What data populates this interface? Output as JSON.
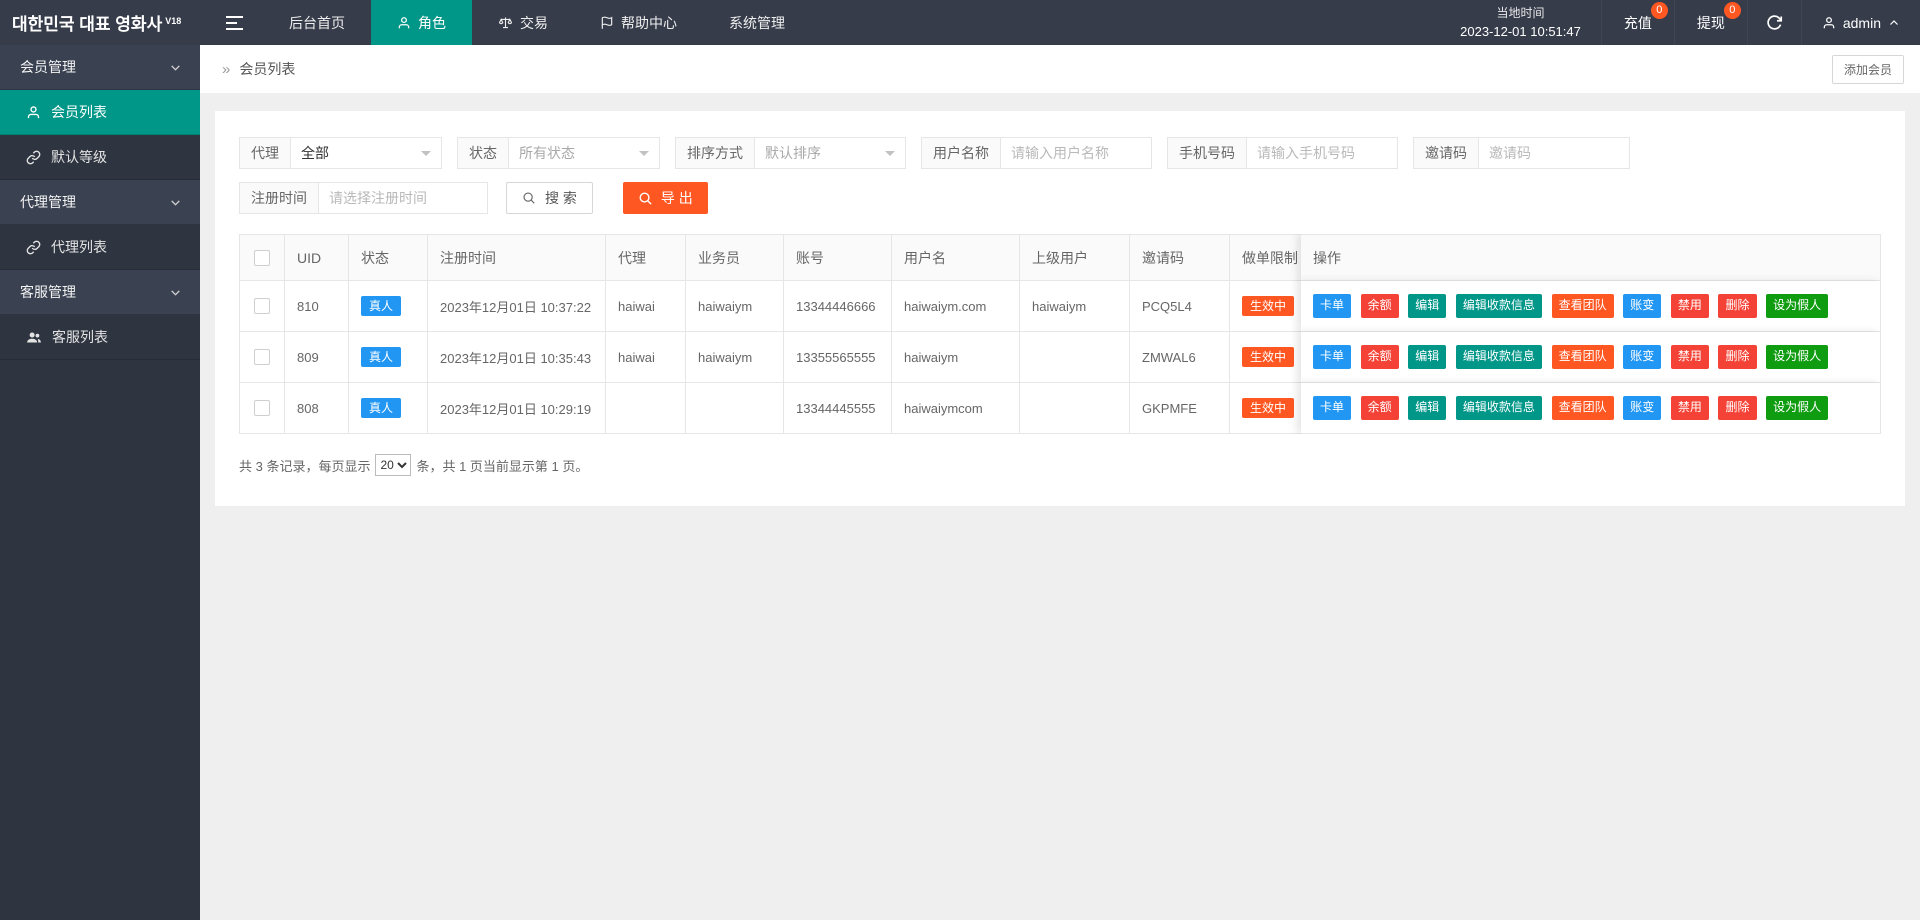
{
  "brand": {
    "title": "대한민국 대표 영화사",
    "version": "V18"
  },
  "topbar": {
    "nav": [
      {
        "label": "后台首页"
      },
      {
        "label": "角色"
      },
      {
        "label": "交易"
      },
      {
        "label": "帮助中心"
      },
      {
        "label": "系统管理"
      }
    ],
    "local_time_label": "当地时间",
    "local_time": "2023-12-01 10:51:47",
    "recharge_label": "充值",
    "recharge_badge": "0",
    "withdraw_label": "提现",
    "withdraw_badge": "0",
    "username": "admin"
  },
  "sidebar": {
    "items": [
      {
        "type": "group",
        "label": "会员管理"
      },
      {
        "type": "item",
        "label": "会员列表",
        "icon": "user-icon",
        "active": true
      },
      {
        "type": "item",
        "label": "默认等级",
        "icon": "link-icon"
      },
      {
        "type": "group",
        "label": "代理管理"
      },
      {
        "type": "item",
        "label": "代理列表",
        "icon": "link-icon"
      },
      {
        "type": "group",
        "label": "客服管理"
      },
      {
        "type": "item",
        "label": "客服列表",
        "icon": "users-icon"
      }
    ]
  },
  "page": {
    "breadcrumb_separator": "»",
    "breadcrumb": "会员列表",
    "add_member_button": "添加会员"
  },
  "filters": {
    "agent_label": "代理",
    "agent_value": "全部",
    "status_label": "状态",
    "status_placeholder": "所有状态",
    "sort_label": "排序方式",
    "sort_placeholder": "默认排序",
    "username_label": "用户名称",
    "username_placeholder": "请输入用户名称",
    "phone_label": "手机号码",
    "phone_placeholder": "请输入手机号码",
    "invite_label": "邀请码",
    "invite_placeholder": "邀请码",
    "regtime_label": "注册时间",
    "regtime_placeholder": "请选择注册时间",
    "search_button": "搜 索",
    "export_button": "导 出"
  },
  "table": {
    "headers": [
      "UID",
      "状态",
      "注册时间",
      "代理",
      "业务员",
      "账号",
      "用户名",
      "上级用户",
      "邀请码",
      "做单限制",
      "操作"
    ],
    "rows": [
      {
        "uid": "810",
        "status": "真人",
        "reg_time": "2023年12月01日 10:37:22",
        "agent": "haiwai",
        "salesman": "haiwaiym",
        "account": "13344446666",
        "username": "haiwaiym.com",
        "parent": "haiwaiym",
        "invite_code": "PCQ5L4",
        "limit_status": "生效中"
      },
      {
        "uid": "809",
        "status": "真人",
        "reg_time": "2023年12月01日 10:35:43",
        "agent": "haiwai",
        "salesman": "haiwaiym",
        "account": "13355565555",
        "username": "haiwaiym",
        "parent": "",
        "invite_code": "ZMWAL6",
        "limit_status": "生效中"
      },
      {
        "uid": "808",
        "status": "真人",
        "reg_time": "2023年12月01日 10:29:19",
        "agent": "",
        "salesman": "",
        "account": "13344445555",
        "username": "haiwaiymcom",
        "parent": "",
        "invite_code": "GKPMFE",
        "limit_status": "生效中"
      }
    ],
    "actions": [
      {
        "label": "卡单",
        "color": "#2196f3"
      },
      {
        "label": "余额",
        "color": "#f44336"
      },
      {
        "label": "编辑",
        "color": "#009688"
      },
      {
        "label": "编辑收款信息",
        "color": "#009688"
      },
      {
        "label": "查看团队",
        "color": "#ff5722"
      },
      {
        "label": "账变",
        "color": "#2196f3"
      },
      {
        "label": "禁用",
        "color": "#f44336"
      },
      {
        "label": "删除",
        "color": "#f44336"
      },
      {
        "label": "设为假人",
        "color": "#109c10"
      }
    ],
    "status_color": "#2196f3",
    "limit_color": "#ff5722"
  },
  "pagination": {
    "prefix": "共 3 条记录，每页显示",
    "page_size": "20",
    "suffix": "条，共 1 页当前显示第 1 页。"
  },
  "colors": {
    "accent": "#009688",
    "topbar": "#363c4a",
    "orange": "#ff5722"
  }
}
